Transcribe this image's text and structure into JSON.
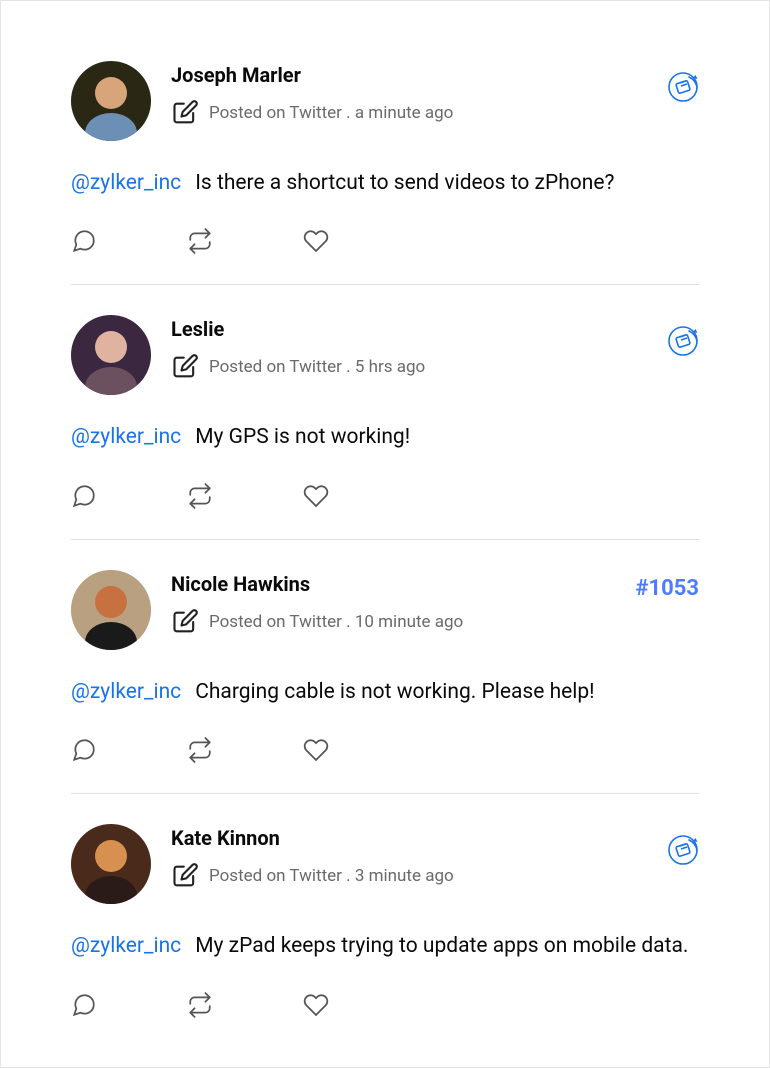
{
  "posts": [
    {
      "author": "Joseph Marler",
      "source": "Posted on Twitter . a minute ago",
      "mention": "@zylker_inc",
      "message": "Is there a shortcut to send videos to zPhone?",
      "ticket": null,
      "showTicketIcon": true
    },
    {
      "author": "Leslie",
      "source": "Posted on Twitter . 5 hrs ago",
      "mention": "@zylker_inc",
      "message": "My GPS is not working!",
      "ticket": null,
      "showTicketIcon": true
    },
    {
      "author": "Nicole Hawkins",
      "source": "Posted on Twitter . 10 minute ago",
      "mention": "@zylker_inc",
      "message": "Charging cable is not working. Please help!",
      "ticket": "#1053",
      "showTicketIcon": false
    },
    {
      "author": "Kate Kinnon",
      "source": "Posted on Twitter . 3 minute ago",
      "mention": "@zylker_inc",
      "message": "My zPad keeps trying to update apps on mobile data.",
      "ticket": null,
      "showTicketIcon": true
    }
  ]
}
